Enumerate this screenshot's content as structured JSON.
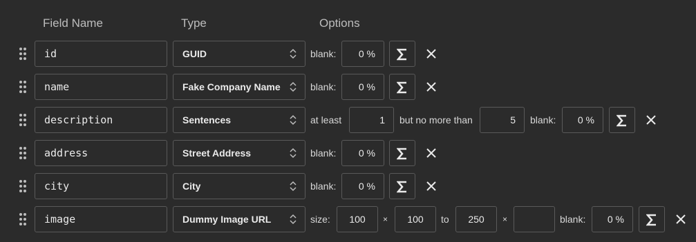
{
  "headers": {
    "field_name": "Field Name",
    "type": "Type",
    "options": "Options"
  },
  "rows": [
    {
      "name": "id",
      "type": "GUID",
      "blank_label": "blank:",
      "blank": "0 %"
    },
    {
      "name": "name",
      "type": "Fake Company Name",
      "blank_label": "blank:",
      "blank": "0 %"
    },
    {
      "name": "description",
      "type": "Sentences",
      "at_least_label": "at least",
      "min": "1",
      "no_more_label": "but no more than",
      "max": "5",
      "blank_label": "blank:",
      "blank": "0 %"
    },
    {
      "name": "address",
      "type": "Street Address",
      "blank_label": "blank:",
      "blank": "0 %"
    },
    {
      "name": "city",
      "type": "City",
      "blank_label": "blank:",
      "blank": "0 %"
    },
    {
      "name": "image",
      "type": "Dummy Image URL",
      "size_label": "size:",
      "w1": "100",
      "times1": "×",
      "h1": "100",
      "to_label": "to",
      "w2": "250",
      "times2": "×",
      "h2": "",
      "blank_label": "blank:",
      "blank": "0 %"
    }
  ]
}
